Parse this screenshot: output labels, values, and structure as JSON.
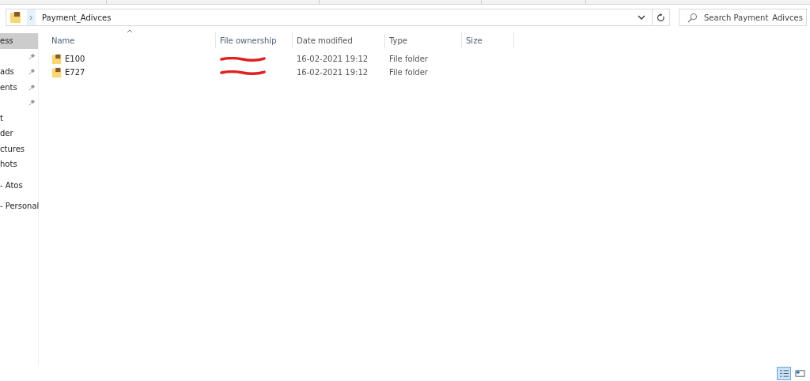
{
  "address_bar": {
    "path": "Payment_Adivces"
  },
  "search": {
    "placeholder": "Search Payment_Adivces"
  },
  "sidebar": {
    "items": [
      {
        "label": "ess",
        "selected": true,
        "pinned": false
      },
      {
        "selected": false,
        "pinned": true
      },
      {
        "label": "ads",
        "selected": false,
        "pinned": true
      },
      {
        "label": "ents",
        "selected": false,
        "pinned": true
      },
      {
        "selected": false,
        "pinned": true
      },
      {
        "label": "t",
        "selected": false,
        "pinned": false
      },
      {
        "label": "der",
        "selected": false,
        "pinned": false
      },
      {
        "label": "ctures",
        "selected": false,
        "pinned": false
      },
      {
        "label": "hots",
        "selected": false,
        "pinned": false
      },
      {
        "label": "- Atos",
        "selected": false,
        "pinned": false,
        "gap": true
      },
      {
        "label": "- Personal",
        "selected": false,
        "pinned": false,
        "gap": true
      }
    ]
  },
  "table": {
    "columns": [
      {
        "label": "Name",
        "sorted": true
      },
      {
        "label": "File ownership",
        "sorted": false
      },
      {
        "label": "Date modified",
        "sorted": false
      },
      {
        "label": "Type",
        "sorted": false
      },
      {
        "label": "Size",
        "sorted": false
      }
    ],
    "rows": [
      {
        "name": "E100",
        "owner_redacted": true,
        "date": "16-02-2021 19:12",
        "type": "File folder"
      },
      {
        "name": "E727",
        "owner_redacted": true,
        "date": "16-02-2021 19:12",
        "type": "File folder"
      }
    ]
  },
  "status_bar": {
    "views": [
      {
        "kind": "details",
        "selected": true
      },
      {
        "kind": "tiles",
        "selected": false
      }
    ]
  }
}
